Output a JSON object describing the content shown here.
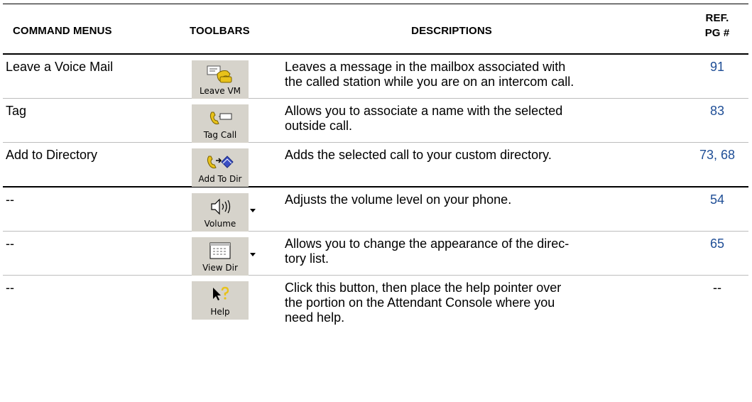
{
  "headers": {
    "command_menus": "COMMAND MENUS",
    "toolbars": "TOOLBARS",
    "descriptions": "DESCRIPTIONS",
    "ref_line1": "REF.",
    "ref_line2": "PG #"
  },
  "rows": [
    {
      "command": "Leave a Voice Mail",
      "toolbar_label": "Leave VM",
      "icon": "leave-voicemail-icon",
      "desc_line1": "Leaves a message in the mailbox associated with",
      "desc_line2": "the called station while you are on an intercom call.",
      "desc_line3": "",
      "ref": "91"
    },
    {
      "command": "Tag",
      "toolbar_label": "Tag Call",
      "icon": "tag-call-icon",
      "desc_line1": "Allows you to associate a name with the selected",
      "desc_line2": "outside call.",
      "desc_line3": "",
      "ref": "83"
    },
    {
      "command": "Add to Directory",
      "toolbar_label": "Add To Dir",
      "icon": "add-to-directory-icon",
      "desc_line1": "Adds the selected call to your custom directory.",
      "desc_line2": "",
      "desc_line3": "",
      "ref": "73, 68"
    },
    {
      "command": "--",
      "toolbar_label": "Volume",
      "icon": "speaker-volume-icon",
      "desc_line1": "Adjusts the volume level on your phone.",
      "desc_line2": "",
      "desc_line3": "",
      "ref": "54"
    },
    {
      "command": "--",
      "toolbar_label": "View Dir",
      "icon": "view-directory-icon",
      "desc_line1": "Allows you to change the appearance of the direc-",
      "desc_line2": "tory list.",
      "desc_line3": "",
      "ref": "65"
    },
    {
      "command": "--",
      "toolbar_label": "Help",
      "icon": "help-pointer-icon",
      "desc_line1": "Click this button, then place the help pointer over",
      "desc_line2": "the portion on the Attendant Console where you",
      "desc_line3": "need help.",
      "ref": "--"
    }
  ],
  "colors": {
    "ref_link": "#1f4e96",
    "button_face": "#d6d3cb",
    "phone_yellow": "#e8c21a",
    "book_blue": "#3b4fc4"
  }
}
